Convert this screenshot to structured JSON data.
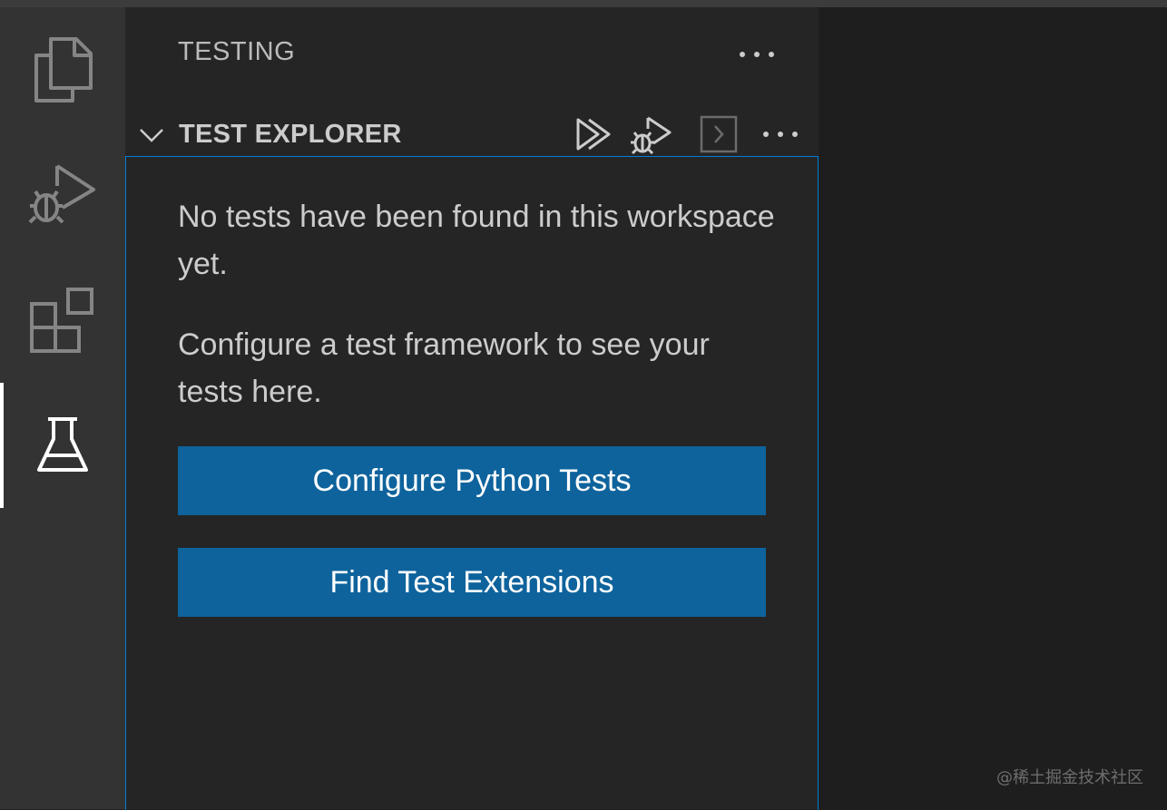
{
  "activity_bar": {
    "items": [
      {
        "icon": "files-icon",
        "active": false
      },
      {
        "icon": "run-debug-icon",
        "active": false
      },
      {
        "icon": "extensions-icon",
        "active": false
      },
      {
        "icon": "testing-flask-icon",
        "active": true
      }
    ]
  },
  "sidebar": {
    "title": "TESTING",
    "more_icon": "ellipsis-icon",
    "section": {
      "title": "TEST EXPLORER",
      "expanded": true,
      "actions": [
        "run-all-tests-icon",
        "debug-all-tests-icon",
        "show-output-icon",
        "ellipsis-icon"
      ],
      "message_line1": "No tests have been found in this workspace yet.",
      "message_line2": "Configure a test framework to see your tests here.",
      "buttons": {
        "configure": "Configure Python Tests",
        "find_extensions": "Find Test Extensions"
      }
    }
  },
  "watermark": "@稀土掘金技术社区",
  "colors": {
    "activity_bar": "#333333",
    "sidebar": "#252526",
    "editor": "#1e1e1e",
    "button": "#0e639c",
    "focus_border": "#007fd4"
  }
}
